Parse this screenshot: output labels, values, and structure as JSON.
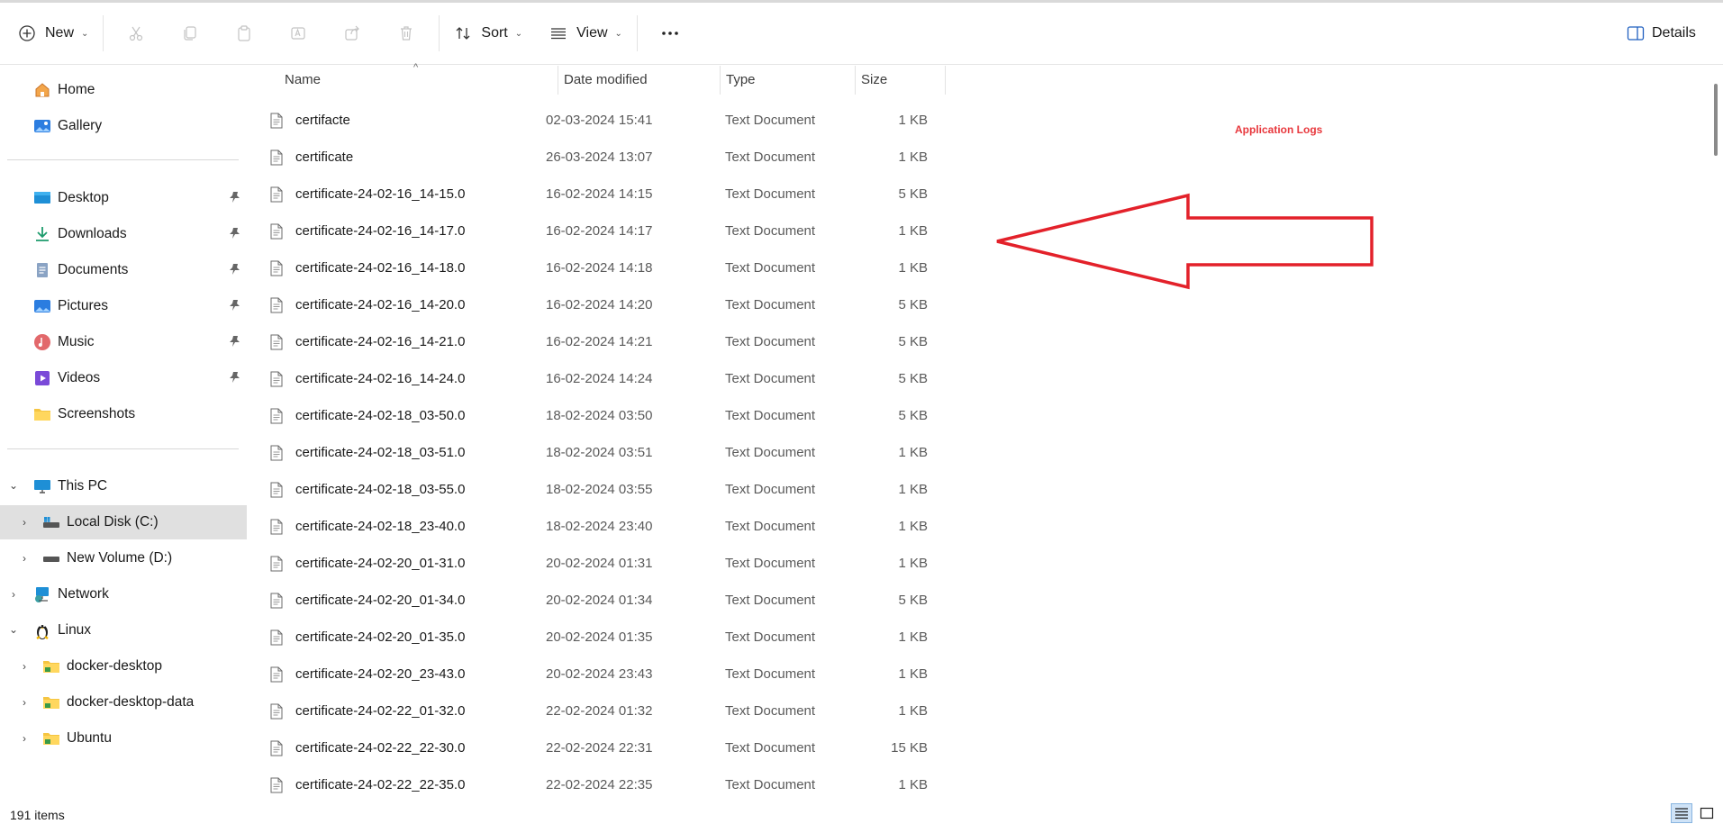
{
  "toolbar": {
    "new_label": "New",
    "sort_label": "Sort",
    "view_label": "View",
    "details_label": "Details"
  },
  "sidebar": {
    "quick": [
      {
        "label": "Home",
        "icon": "home-icon"
      },
      {
        "label": "Gallery",
        "icon": "gallery-icon"
      }
    ],
    "pinned": [
      {
        "label": "Desktop",
        "icon": "desktop-icon"
      },
      {
        "label": "Downloads",
        "icon": "download-icon"
      },
      {
        "label": "Documents",
        "icon": "documents-icon"
      },
      {
        "label": "Pictures",
        "icon": "pictures-icon"
      },
      {
        "label": "Music",
        "icon": "music-icon"
      },
      {
        "label": "Videos",
        "icon": "videos-icon"
      },
      {
        "label": "Screenshots",
        "icon": "folder-icon"
      }
    ],
    "tree": [
      {
        "label": "This PC",
        "icon": "pc-icon",
        "expanded": true
      },
      {
        "label": "Local Disk (C:)",
        "icon": "drive-icon",
        "selected": true
      },
      {
        "label": "New Volume (D:)",
        "icon": "drive-icon"
      },
      {
        "label": "Network",
        "icon": "network-icon"
      },
      {
        "label": "Linux",
        "icon": "linux-icon",
        "expanded": true
      },
      {
        "label": "docker-desktop",
        "icon": "folder-icon"
      },
      {
        "label": "docker-desktop-data",
        "icon": "folder-icon"
      },
      {
        "label": "Ubuntu",
        "icon": "folder-icon"
      }
    ]
  },
  "columns": {
    "name": "Name",
    "date": "Date modified",
    "type": "Type",
    "size": "Size"
  },
  "files": [
    {
      "name": "certifacte",
      "date": "02-03-2024 15:41",
      "type": "Text Document",
      "size": "1 KB"
    },
    {
      "name": "certificate",
      "date": "26-03-2024 13:07",
      "type": "Text Document",
      "size": "1 KB"
    },
    {
      "name": "certificate-24-02-16_14-15.0",
      "date": "16-02-2024 14:15",
      "type": "Text Document",
      "size": "5 KB"
    },
    {
      "name": "certificate-24-02-16_14-17.0",
      "date": "16-02-2024 14:17",
      "type": "Text Document",
      "size": "1 KB"
    },
    {
      "name": "certificate-24-02-16_14-18.0",
      "date": "16-02-2024 14:18",
      "type": "Text Document",
      "size": "1 KB"
    },
    {
      "name": "certificate-24-02-16_14-20.0",
      "date": "16-02-2024 14:20",
      "type": "Text Document",
      "size": "5 KB"
    },
    {
      "name": "certificate-24-02-16_14-21.0",
      "date": "16-02-2024 14:21",
      "type": "Text Document",
      "size": "5 KB"
    },
    {
      "name": "certificate-24-02-16_14-24.0",
      "date": "16-02-2024 14:24",
      "type": "Text Document",
      "size": "5 KB"
    },
    {
      "name": "certificate-24-02-18_03-50.0",
      "date": "18-02-2024 03:50",
      "type": "Text Document",
      "size": "5 KB"
    },
    {
      "name": "certificate-24-02-18_03-51.0",
      "date": "18-02-2024 03:51",
      "type": "Text Document",
      "size": "1 KB"
    },
    {
      "name": "certificate-24-02-18_03-55.0",
      "date": "18-02-2024 03:55",
      "type": "Text Document",
      "size": "1 KB"
    },
    {
      "name": "certificate-24-02-18_23-40.0",
      "date": "18-02-2024 23:40",
      "type": "Text Document",
      "size": "1 KB"
    },
    {
      "name": "certificate-24-02-20_01-31.0",
      "date": "20-02-2024 01:31",
      "type": "Text Document",
      "size": "1 KB"
    },
    {
      "name": "certificate-24-02-20_01-34.0",
      "date": "20-02-2024 01:34",
      "type": "Text Document",
      "size": "5 KB"
    },
    {
      "name": "certificate-24-02-20_01-35.0",
      "date": "20-02-2024 01:35",
      "type": "Text Document",
      "size": "1 KB"
    },
    {
      "name": "certificate-24-02-20_23-43.0",
      "date": "20-02-2024 23:43",
      "type": "Text Document",
      "size": "1 KB"
    },
    {
      "name": "certificate-24-02-22_01-32.0",
      "date": "22-02-2024 01:32",
      "type": "Text Document",
      "size": "1 KB"
    },
    {
      "name": "certificate-24-02-22_22-30.0",
      "date": "22-02-2024 22:31",
      "type": "Text Document",
      "size": "15 KB"
    },
    {
      "name": "certificate-24-02-22_22-35.0",
      "date": "22-02-2024 22:35",
      "type": "Text Document",
      "size": "1 KB"
    }
  ],
  "annotation": {
    "label": "Application Logs",
    "color": "#e8383d"
  },
  "status": {
    "item_count": "191 items"
  }
}
